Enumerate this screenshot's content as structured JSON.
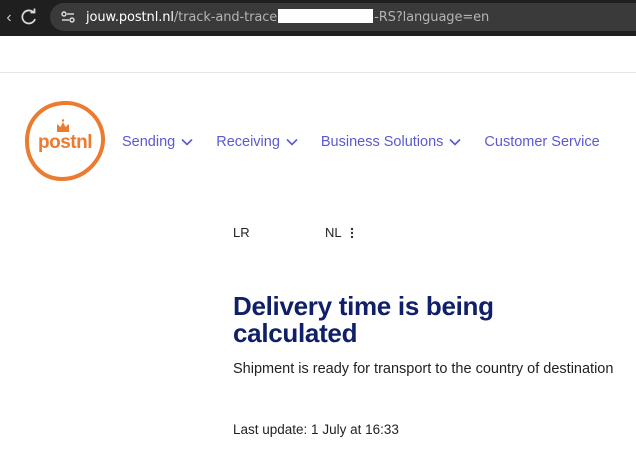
{
  "browser": {
    "url_host": "jouw.postnl.nl",
    "url_path_start": "/track-and-trace",
    "url_path_end": "-RS?language=en"
  },
  "logo": {
    "text": "postnl"
  },
  "nav": {
    "items": [
      {
        "label": "Sending"
      },
      {
        "label": "Receiving"
      },
      {
        "label": "Business Solutions"
      },
      {
        "label": "Customer Service"
      }
    ]
  },
  "shipment": {
    "origin": "LR",
    "destination": "NL",
    "status_title": "Delivery time is being calculated",
    "status_description": "Shipment is ready for transport to the country of destination",
    "last_update": "Last update: 1 July at 16:33"
  },
  "colors": {
    "brand_orange": "#ed7b2f",
    "nav_link": "#5a5ad0",
    "title_navy": "#0f2068"
  },
  "icons": [
    "arrow-back-icon",
    "reload-icon",
    "site-info-icon",
    "chevron-down-icon",
    "more-vertical-icon"
  ]
}
